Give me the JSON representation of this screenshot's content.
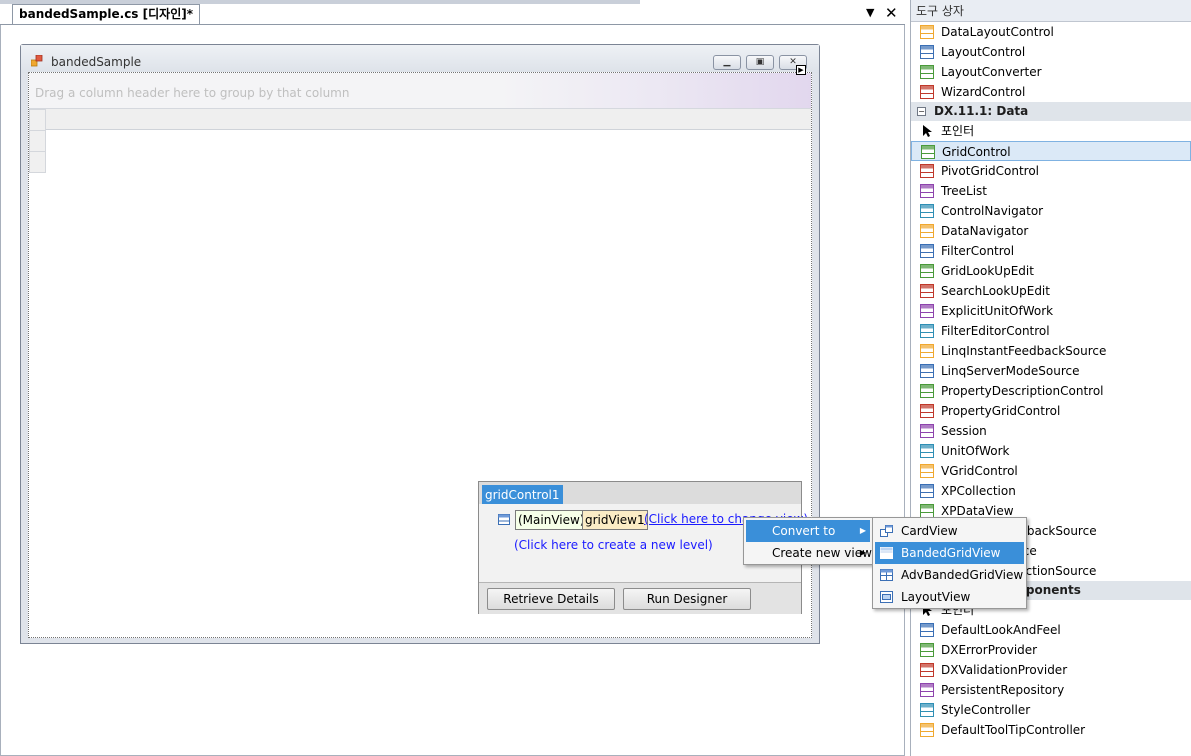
{
  "tab": {
    "title": "bandedSample.cs [디자인]*",
    "dropdown_icon": "triangle-down-icon",
    "close_icon": "close-icon"
  },
  "form": {
    "title": "bandedSample",
    "minimize_icon": "minimize-icon",
    "maximize_icon": "maximize-icon",
    "close_icon": "close-icon",
    "group_panel_text": "Drag a column header here to group by that column"
  },
  "level_designer": {
    "control_name": "gridControl1",
    "main_view_label": "(MainView)",
    "view_name": "gridView1",
    "change_view_link": "(Click here to change view)",
    "new_level_link": "(Click here to create a new level)",
    "retrieve_details_label": "Retrieve Details",
    "run_designer_label": "Run Designer"
  },
  "context_menu": {
    "items": [
      {
        "label": "Convert to"
      },
      {
        "label": "Create new view"
      }
    ]
  },
  "submenu": {
    "items": [
      {
        "label": "CardView"
      },
      {
        "label": "BandedGridView"
      },
      {
        "label": "AdvBandedGridView"
      },
      {
        "label": "LayoutView"
      }
    ]
  },
  "toolbox": {
    "title": "도구 상자",
    "group1": [
      "DataLayoutControl",
      "LayoutControl",
      "LayoutConverter",
      "WizardControl"
    ],
    "cat_data": "DX.11.1: Data",
    "pointer": "포인터",
    "data_items": [
      "GridControl",
      "PivotGridControl",
      "TreeList",
      "ControlNavigator",
      "DataNavigator",
      "FilterControl",
      "GridLookUpEdit",
      "SearchLookUpEdit",
      "ExplicitUnitOfWork",
      "FilterEditorControl",
      "LinqInstantFeedbackSource",
      "LinqServerModeSource",
      "PropertyDescriptionControl",
      "PropertyGridControl",
      "Session",
      "UnitOfWork",
      "VGridControl",
      "XPCollection",
      "XPDataView",
      "XPInstantFeedbackSource",
      "XPObjectSource",
      "XPServerCollectionSource"
    ],
    "cat_components": "DX.11.1: Components",
    "pointer2": "포인터",
    "component_items": [
      "DefaultLookAndFeel",
      "DXErrorProvider",
      "DXValidationProvider",
      "PersistentRepository",
      "StyleController",
      "DefaultToolTipController"
    ]
  },
  "colors": {
    "selection": "#3a8fd9",
    "link": "#1a1aff",
    "toolbox_selected": "#dbe9f7"
  }
}
